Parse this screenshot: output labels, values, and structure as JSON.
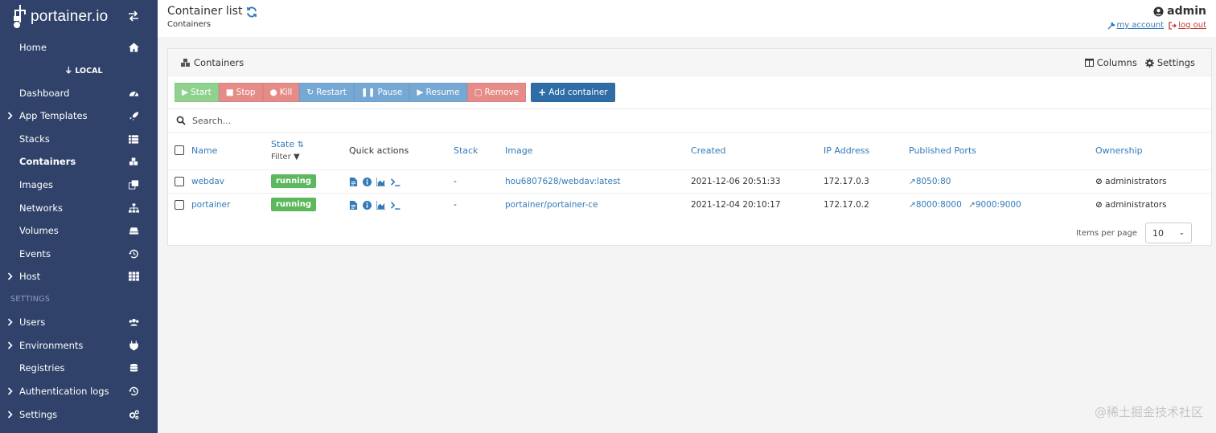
{
  "sidebar": {
    "logo_text": "portainer.io",
    "home_label": "Home",
    "environment_label": "LOCAL",
    "items": [
      {
        "label": "Dashboard",
        "icon": "dashboard-icon",
        "expandable": false
      },
      {
        "label": "App Templates",
        "icon": "rocket-icon",
        "expandable": true
      },
      {
        "label": "Stacks",
        "icon": "th-list-icon",
        "expandable": false
      },
      {
        "label": "Containers",
        "icon": "cubes-icon",
        "expandable": false,
        "active": true
      },
      {
        "label": "Images",
        "icon": "clone-icon",
        "expandable": false
      },
      {
        "label": "Networks",
        "icon": "sitemap-icon",
        "expandable": false
      },
      {
        "label": "Volumes",
        "icon": "hdd-icon",
        "expandable": false
      },
      {
        "label": "Events",
        "icon": "history-icon",
        "expandable": false
      },
      {
        "label": "Host",
        "icon": "th-icon",
        "expandable": true
      }
    ],
    "settings_section_title": "SETTINGS",
    "settings_items": [
      {
        "label": "Users",
        "icon": "users-icon",
        "expandable": true
      },
      {
        "label": "Environments",
        "icon": "plug-icon",
        "expandable": true
      },
      {
        "label": "Registries",
        "icon": "database-icon",
        "expandable": false
      },
      {
        "label": "Authentication logs",
        "icon": "history-icon",
        "expandable": true
      },
      {
        "label": "Settings",
        "icon": "cogs-icon",
        "expandable": true
      }
    ]
  },
  "header": {
    "title": "Container list",
    "breadcrumb": "Containers",
    "user": "admin",
    "my_account": "my account",
    "log_out": "log out"
  },
  "panel": {
    "title": "Containers",
    "columns_label": "Columns",
    "settings_label": "Settings",
    "actions": {
      "start": "Start",
      "stop": "Stop",
      "kill": "Kill",
      "restart": "Restart",
      "pause": "Pause",
      "resume": "Resume",
      "remove": "Remove",
      "add": "Add container"
    },
    "search_placeholder": "Search...",
    "table": {
      "headers": {
        "name": "Name",
        "state": "State",
        "filter": "Filter",
        "quick_actions": "Quick actions",
        "stack": "Stack",
        "image": "Image",
        "created": "Created",
        "ip": "IP Address",
        "ports": "Published Ports",
        "ownership": "Ownership"
      },
      "rows": [
        {
          "name": "webdav",
          "state": "running",
          "stack": "-",
          "image": "hou6807628/webdav:latest",
          "created": "2021-12-06 20:51:33",
          "ip": "172.17.0.3",
          "ports": [
            "8050:80"
          ],
          "ownership": "administrators"
        },
        {
          "name": "portainer",
          "state": "running",
          "stack": "-",
          "image": "portainer/portainer-ce",
          "created": "2021-12-04 20:10:17",
          "ip": "172.17.0.2",
          "ports": [
            "8000:8000",
            "9000:9000"
          ],
          "ownership": "administrators"
        }
      ]
    },
    "items_per_page_label": "Items per page",
    "items_per_page_value": "10"
  },
  "watermark": "@稀土掘金技术社区",
  "colors": {
    "sidebar_bg": "#30426a",
    "link": "#337ab7",
    "running": "#5cb85c",
    "add_button": "#2f6da6"
  }
}
